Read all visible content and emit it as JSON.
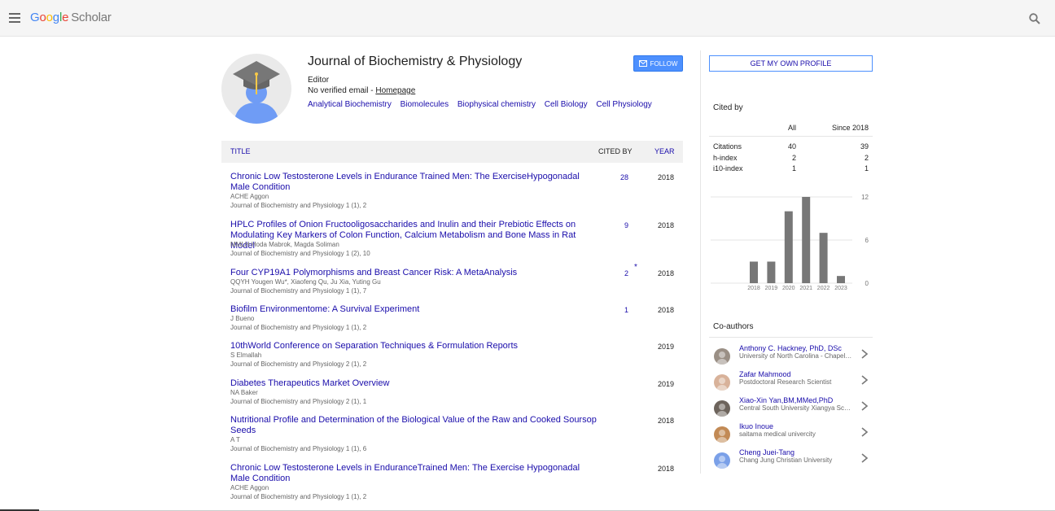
{
  "header": {
    "logo_google": [
      "G",
      "o",
      "o",
      "g",
      "l",
      "e"
    ],
    "logo_scholar": "Scholar"
  },
  "profile": {
    "name": "Journal of Biochemistry & Physiology",
    "affiliation": "Editor",
    "email_prefix": "No verified email - ",
    "homepage_label": "Homepage",
    "interests": [
      "Analytical Biochemistry",
      "Biomolecules",
      "Biophysical chemistry",
      "Cell Biology",
      "Cell Physiology"
    ],
    "follow_label": "FOLLOW"
  },
  "table": {
    "col_title": "TITLE",
    "col_cited": "CITED BY",
    "col_year": "YEAR",
    "rows": [
      {
        "title": "Chronic Low Testosterone Levels in Endurance Trained Men: The ExerciseHypogonadal Male Condition",
        "authors": "ACHE Aggon",
        "venue": "Journal of Biochemistry and Physiology 1 (1), 2",
        "cited": "28",
        "star": "",
        "year": "2018"
      },
      {
        "title": "HPLC Profiles of Onion Fructooligosaccharides and Inulin and their Prebiotic Effects on Modulating Key Markers of Colon Function, Calcium Metabolism and Bone Mass in Rat Model",
        "authors": "MMLH Hoda Mabrok, Magda Soliman",
        "venue": "Journal of Biochemistry and Physiology 1 (2), 10",
        "cited": "9",
        "star": "",
        "year": "2018"
      },
      {
        "title": "Four CYP19A1 Polymorphisms and Breast Cancer Risk: A MetaAnalysis",
        "authors": "QQYH Yougen Wu*, Xiaofeng Qu, Ju Xia, Yuting Gu",
        "venue": "Journal of Biochemistry and Physiology 1 (1), 7",
        "cited": "2",
        "star": "*",
        "year": "2018"
      },
      {
        "title": "Biofilm Environmentome: A Survival Experiment",
        "authors": "J Bueno",
        "venue": "Journal of Biochemistry and Physiology 1 (1), 2",
        "cited": "1",
        "star": "",
        "year": "2018"
      },
      {
        "title": "10thWorld Conference on Separation Techniques & Formulation Reports",
        "authors": "S Elmallah",
        "venue": "Journal of Biochemistry and Physiology 2 (1), 2",
        "cited": "",
        "star": "",
        "year": "2019"
      },
      {
        "title": "Diabetes Therapeutics Market Overview",
        "authors": "NA Baker",
        "venue": "Journal of Biochemistry and Physiology 2 (1), 1",
        "cited": "",
        "star": "",
        "year": "2019"
      },
      {
        "title": "Nutritional Profile and Determination of the Biological Value of the Raw and Cooked Soursop Seeds",
        "authors": "A T",
        "venue": "Journal of Biochemistry and Physiology 1 (1), 6",
        "cited": "",
        "star": "",
        "year": "2018"
      },
      {
        "title": "Chronic Low Testosterone Levels in EnduranceTrained Men: The Exercise Hypogonadal Male Condition",
        "authors": "ACHE Aggon",
        "venue": "Journal of Biochemistry and Physiology 1 (1), 2",
        "cited": "",
        "star": "",
        "year": "2018"
      }
    ]
  },
  "sidebar": {
    "own_profile_label": "GET MY OWN PROFILE",
    "cited_by_label": "Cited by",
    "col_all": "All",
    "col_since": "Since 2018",
    "metrics": [
      {
        "label": "Citations",
        "all": "40",
        "since": "39"
      },
      {
        "label": "h-index",
        "all": "2",
        "since": "2"
      },
      {
        "label": "i10-index",
        "all": "1",
        "since": "1"
      }
    ],
    "coauthors_label": "Co-authors",
    "coauthors": [
      {
        "name": "Anthony C. Hackney, PhD, DSc",
        "affiliation": "University of North Carolina - Chapel Hill"
      },
      {
        "name": "Zafar Mahmood",
        "affiliation": "Postdoctoral Research Scientist"
      },
      {
        "name": "Xiao-Xin Yan,BM,MMed,PhD",
        "affiliation": "Central South University Xiangya School of Medicine"
      },
      {
        "name": "Ikuo Inoue",
        "affiliation": "saitama medical univercity"
      },
      {
        "name": "Cheng Juei-Tang",
        "affiliation": "Chang Jung Christian University"
      }
    ]
  },
  "chart_data": {
    "type": "bar",
    "categories": [
      "2018",
      "2019",
      "2020",
      "2021",
      "2022",
      "2023"
    ],
    "values": [
      3,
      3,
      10,
      12,
      7,
      1
    ],
    "yticks": [
      "12",
      "6",
      "0"
    ],
    "ylim": [
      0,
      12
    ],
    "bar_color": "#777777"
  }
}
